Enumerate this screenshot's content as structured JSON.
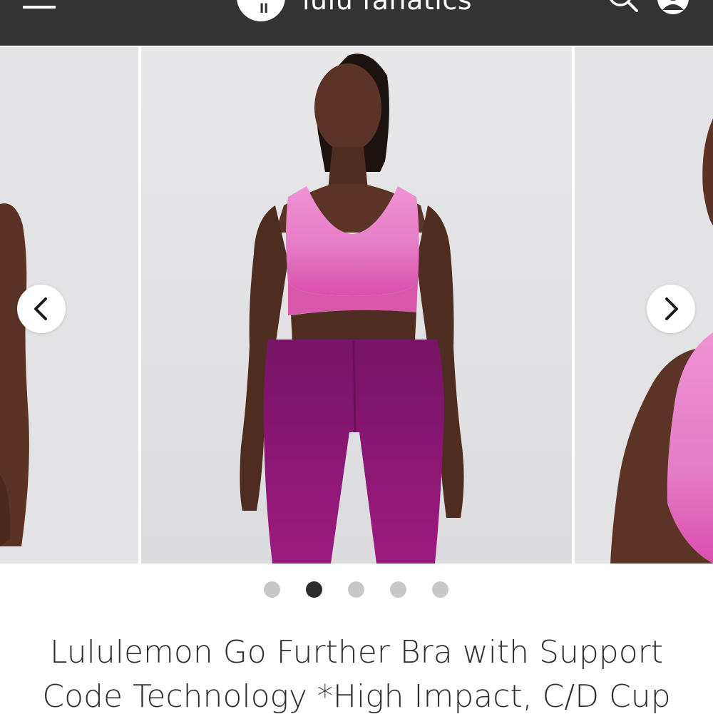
{
  "header": {
    "logo_text": "ll",
    "brand_name": "lulu fanatics",
    "icons": {
      "menu": "hamburger-menu-icon",
      "search": "search-icon",
      "account": "user-account-icon"
    },
    "colors": {
      "background": "#333333",
      "foreground": "#ffffff"
    }
  },
  "gallery": {
    "slide_count": 5,
    "active_slide": 2,
    "icons": {
      "previous": "chevron-left-icon",
      "next": "chevron-right-icon"
    },
    "colors": {
      "background": "#e3e3e5",
      "bra": "#e57cc6",
      "leggings": "#8a1774",
      "active_dot": "#2d2d2d",
      "inactive_dot": "#c8c8c8"
    }
  },
  "product": {
    "title": "Lululemon Go Further Bra with Support Code Technology *High Impact, C/D Cup"
  }
}
